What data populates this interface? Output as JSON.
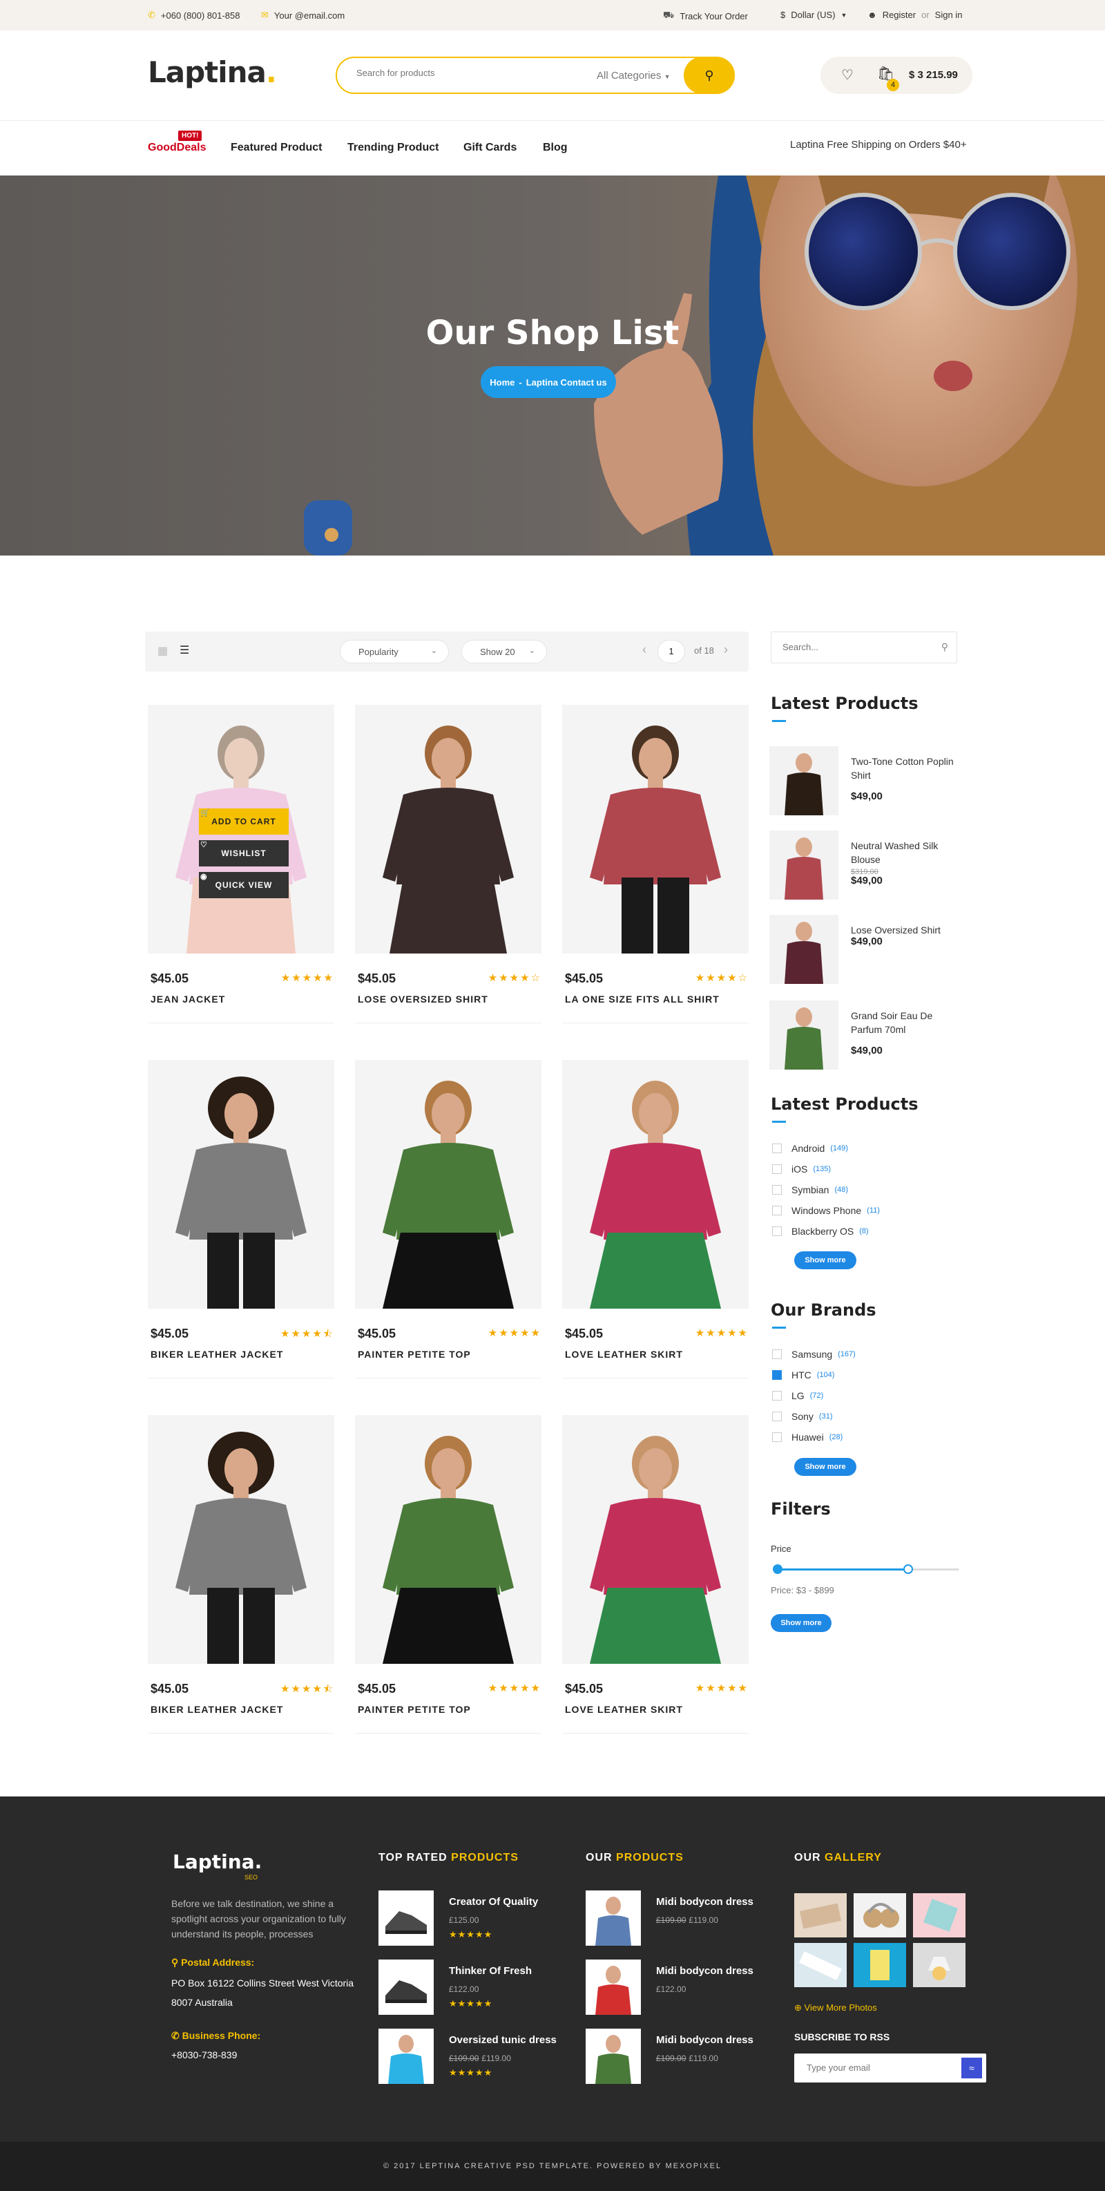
{
  "topbar": {
    "phone": "+060 (800) 801-858",
    "email": "Your @email.com",
    "track": "Track Your Order",
    "currency": "Dollar (US)",
    "register": "Register",
    "or": "or",
    "signin": "Sign in"
  },
  "header": {
    "logo": "Laptina",
    "search_placeholder": "Search for products",
    "category": "All Categories",
    "cart_count": "4",
    "cart_total": "$ 3 215.99"
  },
  "nav": {
    "hot_badge": "HOT!",
    "items": [
      "GoodDeals",
      "Featured Product",
      "Trending Product",
      "Gift Cards",
      "Blog"
    ],
    "shipping": "Laptina Free Shipping on Orders $40+"
  },
  "hero": {
    "title": "Our Shop List",
    "crumb_home": "Home",
    "crumb_sep": "-",
    "crumb_current": "Laptina Contact us"
  },
  "toolbar": {
    "sort": "Popularity",
    "show": "Show 20",
    "page": "1",
    "of": "of 18"
  },
  "quick_actions": {
    "add_to_cart": "ADD TO CART",
    "wishlist": "WISHLIST",
    "quick_view": "QUICK VIEW"
  },
  "products": [
    {
      "price": "$45.05",
      "name": "JEAN JACKET",
      "rating": 5
    },
    {
      "price": "$45.05",
      "name": "LOSE OVERSIZED SHIRT",
      "rating": 4
    },
    {
      "price": "$45.05",
      "name": "LA ONE SIZE FITS ALL SHIRT",
      "rating": 4
    },
    {
      "price": "$45.05",
      "name": "BIKER LEATHER JACKET",
      "rating": 4.5
    },
    {
      "price": "$45.05",
      "name": "PAINTER PETITE TOP",
      "rating": 5
    },
    {
      "price": "$45.05",
      "name": "LOVE LEATHER SKIRT",
      "rating": 5
    },
    {
      "price": "$45.05",
      "name": "BIKER LEATHER JACKET",
      "rating": 4.5
    },
    {
      "price": "$45.05",
      "name": "PAINTER PETITE TOP",
      "rating": 5
    },
    {
      "price": "$45.05",
      "name": "LOVE LEATHER SKIRT",
      "rating": 5
    }
  ],
  "sidebar": {
    "search_placeholder": "Search...",
    "latest_title": "Latest Products",
    "latest": [
      {
        "name": "Two-Tone Cotton Poplin Shirt",
        "old": "",
        "price": "$49,00"
      },
      {
        "name": "Neutral Washed Silk Blouse",
        "old": "$319,00",
        "price": "$49,00"
      },
      {
        "name": "Lose Oversized Shirt",
        "old": "",
        "price": "$49,00"
      },
      {
        "name": "Grand Soir Eau De Parfum 70ml",
        "old": "",
        "price": "$49,00"
      }
    ],
    "os_title": "Latest Products",
    "os": [
      {
        "label": "Android",
        "count": "(149)",
        "checked": false
      },
      {
        "label": "iOS",
        "count": "(135)",
        "checked": false
      },
      {
        "label": "Symbian",
        "count": "(48)",
        "checked": false
      },
      {
        "label": "Windows Phone",
        "count": "(11)",
        "checked": false
      },
      {
        "label": "Blackberry OS",
        "count": "(8)",
        "checked": false
      }
    ],
    "brands_title": "Our Brands",
    "brands": [
      {
        "label": "Samsung",
        "count": "(167)",
        "checked": false
      },
      {
        "label": "HTC",
        "count": "(104)",
        "checked": true
      },
      {
        "label": "LG",
        "count": "(72)",
        "checked": false
      },
      {
        "label": "Sony",
        "count": "(31)",
        "checked": false
      },
      {
        "label": "Huawei",
        "count": "(28)",
        "checked": false
      }
    ],
    "show_more": "Show more",
    "filters_title": "Filters",
    "price_label": "Price",
    "price_range": "Price: $3 - $899",
    "price_min_fraction": 0.0,
    "price_max_fraction": 0.72
  },
  "footer": {
    "logo": "Laptina.",
    "logo_sub": "SEO",
    "about": "Before we talk destination, we shine a spotlight across your organization to fully understand its people, processes",
    "postal_label": "Postal Address:",
    "postal": "PO Box 16122 Collins Street West Victoria 8007 Australia",
    "phone_label": "Business Phone:",
    "phone": "+8030-738-839",
    "top_rated_a": "TOP RATED",
    "top_rated_b": "PRODUCTS",
    "top_rated": [
      {
        "name": "Creator Of Quality",
        "old": "",
        "price": "£125.00"
      },
      {
        "name": "Thinker Of Fresh",
        "old": "",
        "price": "£122.00"
      },
      {
        "name": "Oversized tunic dress",
        "old": "£109.00",
        "price": "£119.00"
      }
    ],
    "our_products_a": "OUR",
    "our_products_b": "PRODUCTS",
    "our_products": [
      {
        "name": "Midi bodycon dress",
        "old": "£109.00",
        "price": "£119.00"
      },
      {
        "name": "Midi bodycon dress",
        "old": "",
        "price": "£122.00"
      },
      {
        "name": "Midi bodycon dress",
        "old": "£109.00",
        "price": "£119.00"
      }
    ],
    "gallery_a": "OUR",
    "gallery_b": "GALLERY",
    "view_more": "View More Photos",
    "rss_title": "SUBSCRIBE TO RSS",
    "rss_placeholder": "Type your email",
    "copyright": "© 2017 LEPTINA CREATIVE PSD TEMPLATE. POWERED BY MEXOPIXEL"
  },
  "colors": {
    "accent": "#f5c000",
    "blue": "#1e9be8",
    "hot": "#d0021b",
    "footer_bg": "#2a2a2a"
  }
}
